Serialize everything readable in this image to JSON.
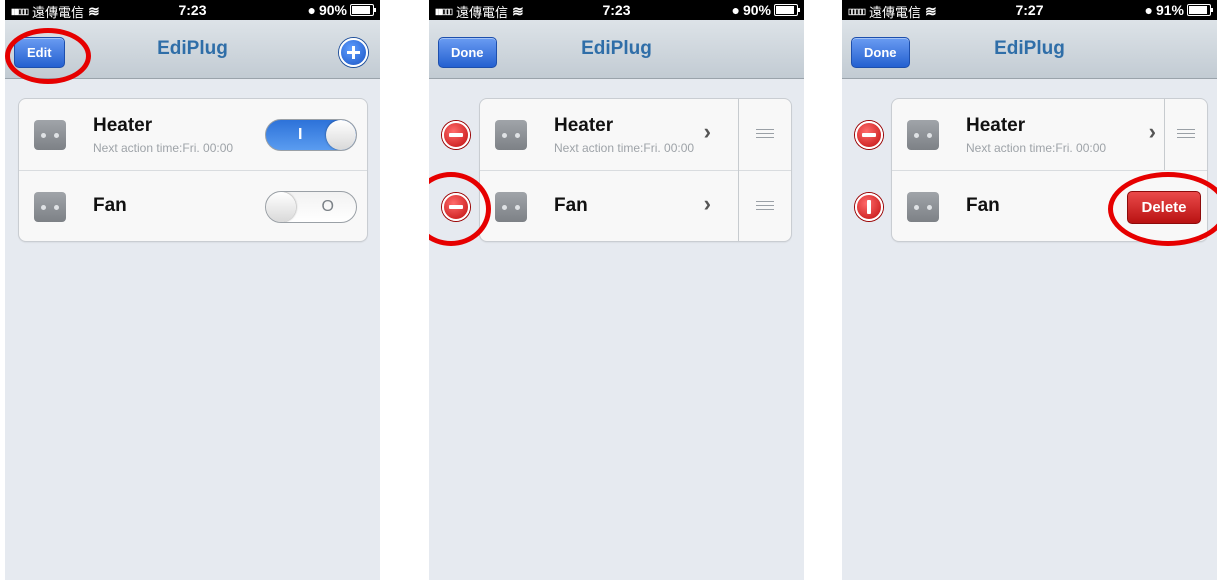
{
  "screens": [
    {
      "status": {
        "carrier": "遠傳電信",
        "time": "7:23",
        "battery": "90%",
        "battery_level": 0.9
      },
      "nav": {
        "left_button": "Edit",
        "title": "EdiPlug"
      },
      "devices": [
        {
          "name": "Heater",
          "subtitle": "Next action time:Fri. 00:00",
          "switch_on": true,
          "switch_glyph": "I"
        },
        {
          "name": "Fan",
          "switch_on": false,
          "switch_glyph": "O"
        }
      ]
    },
    {
      "status": {
        "carrier": "遠傳電信",
        "time": "7:23",
        "battery": "90%",
        "battery_level": 0.9
      },
      "nav": {
        "left_button": "Done",
        "title": "EdiPlug"
      },
      "devices": [
        {
          "name": "Heater",
          "subtitle": "Next action time:Fri. 00:00"
        },
        {
          "name": "Fan"
        }
      ]
    },
    {
      "status": {
        "carrier": "遠傳電信",
        "time": "7:27",
        "battery": "91%",
        "battery_level": 0.91
      },
      "nav": {
        "left_button": "Done",
        "title": "EdiPlug"
      },
      "devices": [
        {
          "name": "Heater",
          "subtitle": "Next action time:Fri. 00:00"
        },
        {
          "name": "Fan",
          "delete_label": "Delete"
        }
      ]
    }
  ],
  "icons": [
    "wifi-icon",
    "battery-icon",
    "add-icon",
    "plug-icon",
    "chevron-right-icon",
    "reorder-handle-icon",
    "delete-minus-icon"
  ],
  "colors": {
    "accent": "#2f6ea8",
    "delete": "#c41a1a",
    "highlight_ring": "#e60000"
  }
}
